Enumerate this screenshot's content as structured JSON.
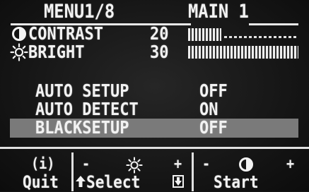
{
  "header": {
    "menu_label": "MENU1/8",
    "page_label": "MAIN 1"
  },
  "adjustments": [
    {
      "label": "CONTRAST",
      "value": "20",
      "icon": "contrast-icon",
      "level_fraction": 0.3
    },
    {
      "label": "BRIGHT",
      "value": "30",
      "icon": "sun-icon",
      "level_fraction": 1.0
    }
  ],
  "options": [
    {
      "label": "AUTO SETUP",
      "value": "OFF",
      "highlighted": false
    },
    {
      "label": "AUTO DETECT",
      "value": "ON",
      "highlighted": false
    },
    {
      "label": "BLACKSETUP",
      "value": "OFF",
      "highlighted": true
    }
  ],
  "footer": {
    "quit_icon": "(i)",
    "quit_label": "Quit",
    "minus": "-",
    "plus": "+",
    "select_label": "Select",
    "start_label": "Start",
    "center_icon": "sun-icon",
    "right_icon": "contrast-icon"
  },
  "colors": {
    "background": "#141414",
    "text": "#f2f2f2",
    "highlight": "#7a7a7a"
  }
}
